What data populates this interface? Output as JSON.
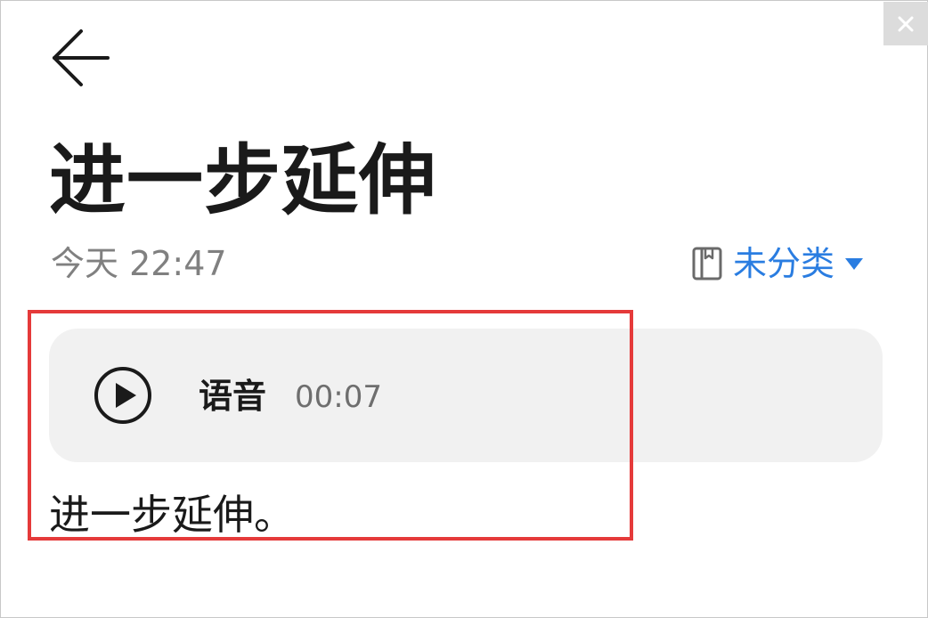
{
  "window": {
    "close_glyph": "×"
  },
  "header": {
    "back_icon": "arrow-left-icon"
  },
  "note": {
    "title": "进一步延伸",
    "timestamp": "今天 22:47",
    "category": {
      "label": "未分类",
      "icon": "notebook-icon",
      "dropdown_icon": "caret-down-icon",
      "accent_color": "#2a7de1"
    },
    "voice_attachment": {
      "label": "语音",
      "duration": "00:07",
      "icon": "play-icon"
    },
    "body_text": "进一步延伸。"
  },
  "highlight": {
    "color": "#e53a3a"
  }
}
